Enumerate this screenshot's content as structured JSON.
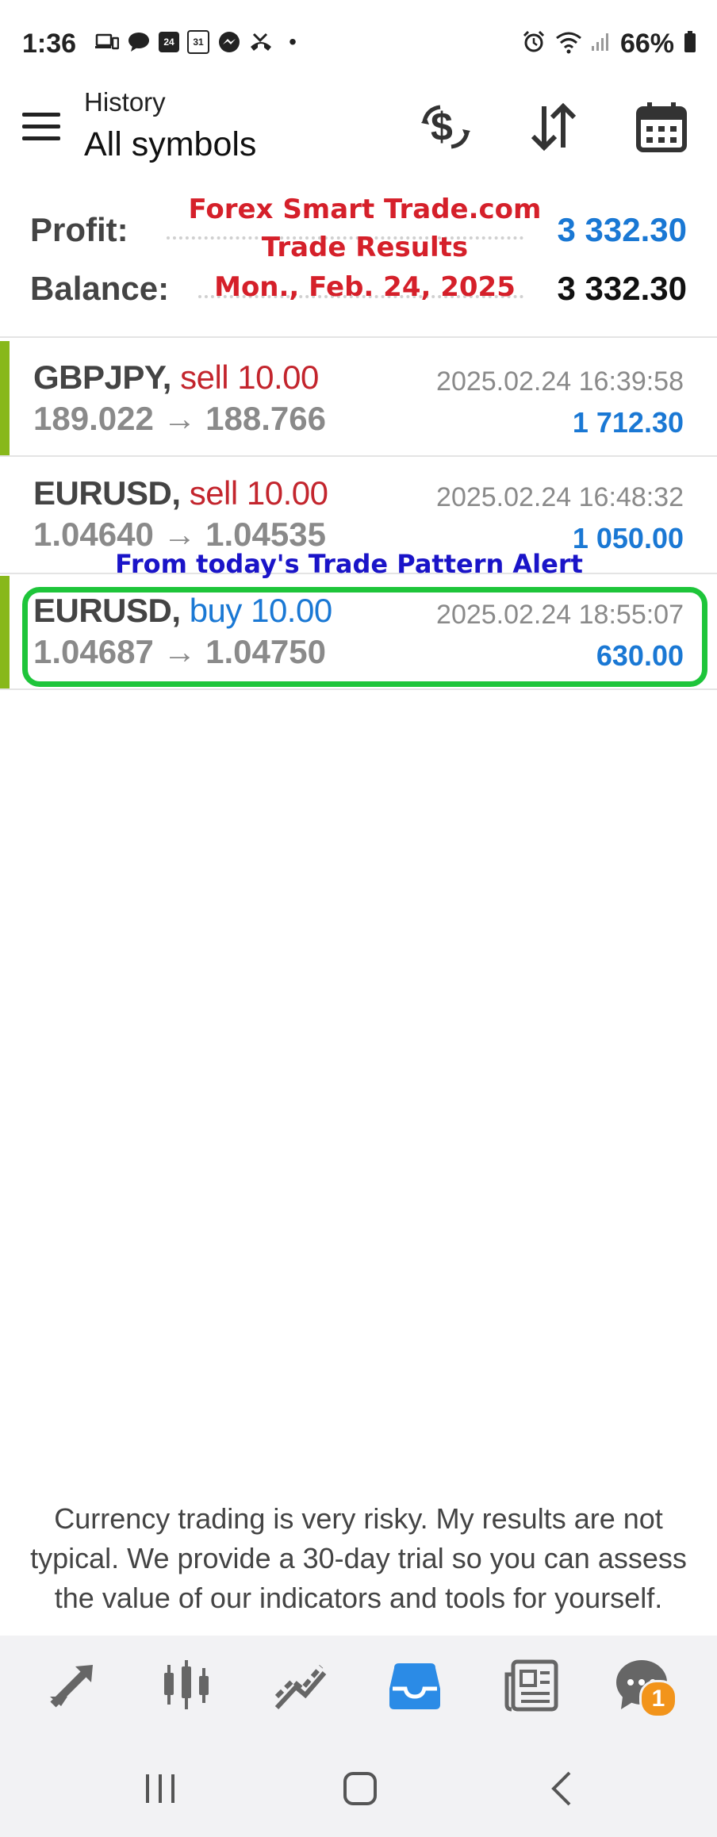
{
  "status_bar": {
    "time": "1:36",
    "calendar_day_1": "24",
    "calendar_day_2": "31",
    "dot": "•",
    "battery": "66%"
  },
  "toolbar": {
    "subtitle": "History",
    "title": "All symbols"
  },
  "summary": {
    "profit_label": "Profit:",
    "profit_value": "3 332.30",
    "balance_label": "Balance:",
    "balance_value": "3 332.30"
  },
  "overlay": {
    "line1": "Forex Smart Trade.com",
    "line2": "Trade Results",
    "line3": "Mon., Feb. 24, 2025",
    "alert": "From today's Trade Pattern Alert"
  },
  "trades": [
    {
      "symbol": "GBPJPY,",
      "side": "sell 10.00",
      "prices": "189.022 → 188.766",
      "time": "2025.02.24 16:39:58",
      "profit": "1 712.30"
    },
    {
      "symbol": "EURUSD,",
      "side": "sell 10.00",
      "prices": "1.04640 → 1.04535",
      "time": "2025.02.24 16:48:32",
      "profit": "1 050.00"
    },
    {
      "symbol": "EURUSD,",
      "side": "buy 10.00",
      "prices": "1.04687 → 1.04750",
      "time": "2025.02.24 18:55:07",
      "profit": "630.00"
    }
  ],
  "disclaimer": {
    "line1": "Currency trading is very risky. My results are not",
    "line2": "typical. We provide a 30-day trial so you can assess",
    "line3": "the value of our indicators and tools for yourself."
  },
  "bottom_nav": {
    "active": "history-tab",
    "badge": "1"
  },
  "colors": {
    "sell": "#c3252d",
    "buy": "#1a78d4",
    "profit": "#1a78d4",
    "accent_bar": "#88b81a",
    "highlight": "#1ec53a",
    "overlay_red": "#d5202a",
    "overlay_blue": "#1a14c8",
    "active_tab": "#2b8be6"
  },
  "icons": [
    "hamburger-menu-icon",
    "dollar-exchange-icon",
    "sort-icon",
    "calendar-icon",
    "trade-icon",
    "quotes-icon",
    "chart-icon",
    "history-icon",
    "news-icon",
    "chat-icon"
  ]
}
